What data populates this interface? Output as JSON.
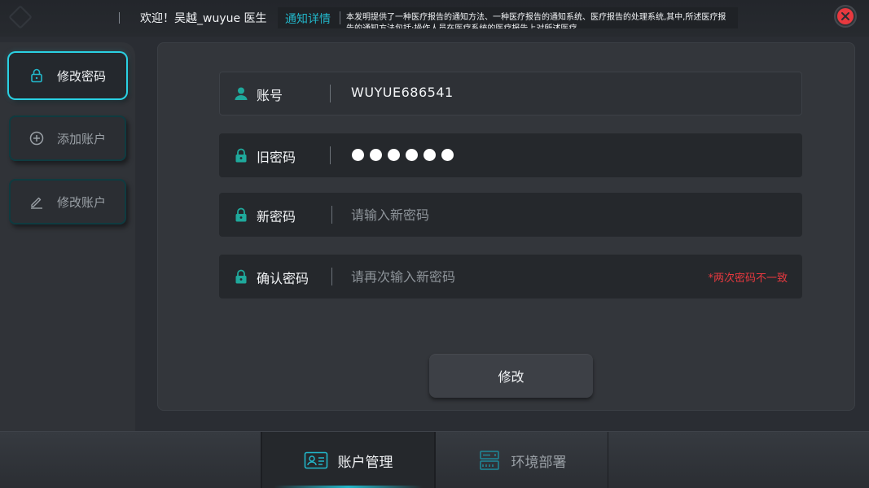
{
  "header": {
    "welcome": "欢迎！吴越_wuyue 医生",
    "notice_label": "通知详情",
    "notice_text": "本发明提供了一种医疗报告的通知方法、一种医疗报告的通知系统、医疗报告的处理系统,其中,所述医疗报告的通知方法包括:操作人员在医疗系统的医疗报告上对所述医疗"
  },
  "sidebar": {
    "items": [
      {
        "label": "修改密码",
        "icon": "lock-icon",
        "active": true
      },
      {
        "label": "添加账户",
        "icon": "plus-circle-icon",
        "active": false
      },
      {
        "label": "修改账户",
        "icon": "pencil-icon",
        "active": false
      }
    ]
  },
  "form": {
    "account": {
      "label": "账号",
      "value": "WUYUE686541"
    },
    "old_password": {
      "label": "旧密码",
      "dots": 6
    },
    "new_password": {
      "label": "新密码",
      "placeholder": "请输入新密码"
    },
    "confirm_password": {
      "label": "确认密码",
      "placeholder": "请再次输入新密码",
      "error": "*两次密码不一致"
    },
    "submit_label": "修改"
  },
  "tabs": [
    {
      "label": "账户管理",
      "icon": "id-card-icon",
      "active": true
    },
    {
      "label": "环境部署",
      "icon": "server-icon",
      "active": false
    }
  ],
  "colors": {
    "accent": "#22b6c9",
    "error": "#e8393f",
    "icon_teal": "#1fa99c"
  }
}
